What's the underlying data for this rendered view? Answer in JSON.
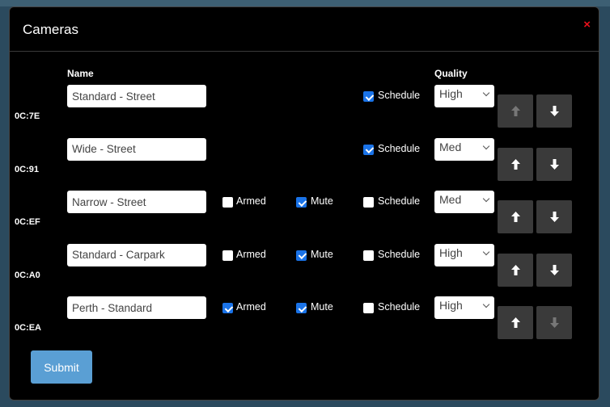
{
  "dialog": {
    "title": "Cameras",
    "close_label": "×"
  },
  "columns": {
    "name": "Name",
    "quality": "Quality"
  },
  "labels": {
    "armed": "Armed",
    "mute": "Mute",
    "schedule": "Schedule"
  },
  "cameras": [
    {
      "mac": "0C:7E",
      "name": "Standard - Street",
      "has_armed_mute": false,
      "armed": false,
      "mute": false,
      "schedule": true,
      "quality": "High",
      "up_enabled": false,
      "down_enabled": true
    },
    {
      "mac": "0C:91",
      "name": "Wide - Street",
      "has_armed_mute": false,
      "armed": false,
      "mute": false,
      "schedule": true,
      "quality": "Med",
      "up_enabled": true,
      "down_enabled": true
    },
    {
      "mac": "0C:EF",
      "name": "Narrow - Street",
      "has_armed_mute": true,
      "armed": false,
      "mute": true,
      "schedule": false,
      "quality": "Med",
      "up_enabled": true,
      "down_enabled": true
    },
    {
      "mac": "0C:A0",
      "name": "Standard - Carpark",
      "has_armed_mute": true,
      "armed": false,
      "mute": true,
      "schedule": false,
      "quality": "High",
      "up_enabled": true,
      "down_enabled": true
    },
    {
      "mac": "0C:EA",
      "name": "Perth - Standard",
      "has_armed_mute": true,
      "armed": true,
      "mute": true,
      "schedule": false,
      "quality": "High",
      "up_enabled": true,
      "down_enabled": false
    }
  ],
  "submit_label": "Submit",
  "colors": {
    "checkbox_checked": "#1a73e8",
    "submit": "#5a9fd4",
    "close": "#e8101a"
  }
}
